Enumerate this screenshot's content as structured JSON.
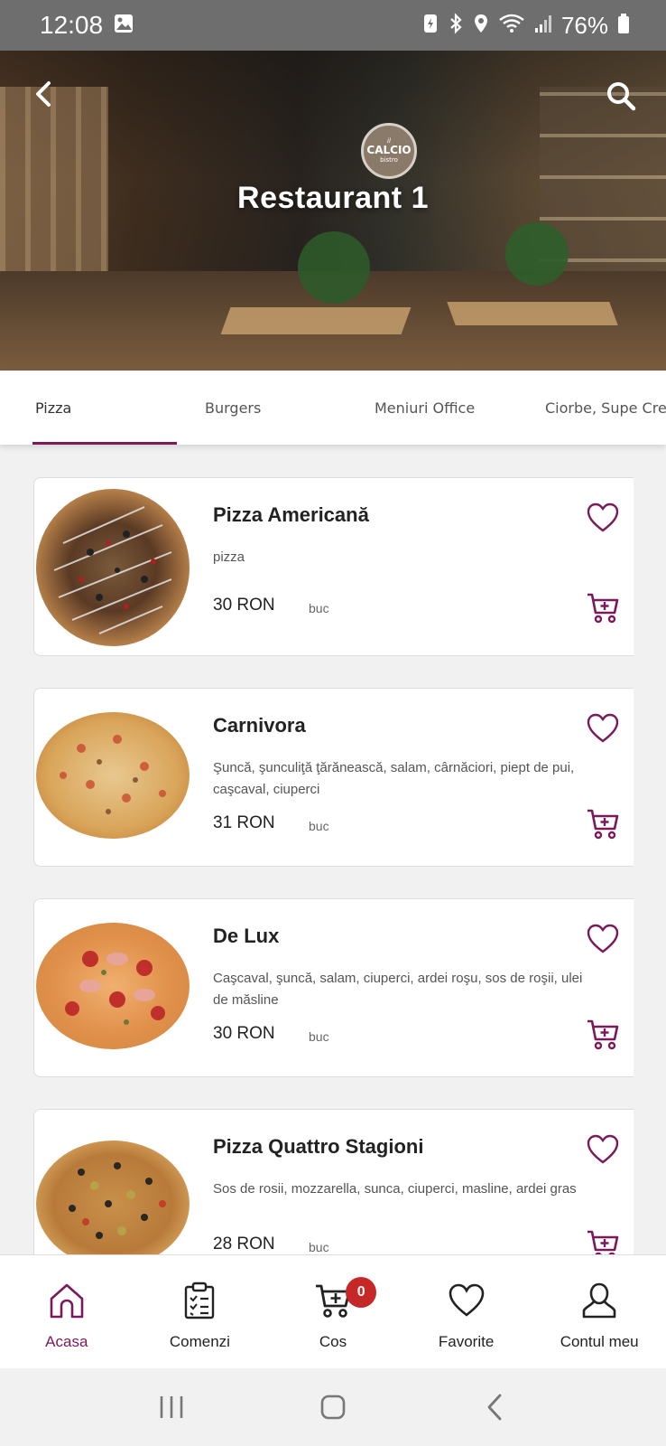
{
  "status_bar": {
    "time": "12:08",
    "battery": "76%"
  },
  "header": {
    "title": "Restaurant 1",
    "logo": {
      "top": "il",
      "name": "CALCIO",
      "sub": "bistro"
    }
  },
  "tabs": [
    {
      "label": "Pizza",
      "active": true
    },
    {
      "label": "Burgers",
      "active": false
    },
    {
      "label": "Meniuri Office",
      "active": false
    },
    {
      "label": "Ciorbe, Supe Creme",
      "active": false
    }
  ],
  "products": [
    {
      "name": "Pizza Americană",
      "description": "pizza",
      "price": "30 RON",
      "unit": "buc"
    },
    {
      "name": "Carnivora",
      "description": "Şuncă, şunculiţă ţărănească, salam, cârnăciori, piept de pui, caşcaval, ciuperci",
      "price": "31 RON",
      "unit": "buc"
    },
    {
      "name": "De Lux",
      "description": "Caşcaval, şuncă, salam, ciuperci, ardei roşu, sos de roşii, ulei de măsline",
      "price": "30 RON",
      "unit": "buc"
    },
    {
      "name": "Pizza Quattro Stagioni",
      "description": "Sos de rosii, mozzarella, sunca, ciuperci, masline, ardei gras",
      "price": "28 RON",
      "unit": "buc"
    }
  ],
  "bottom_nav": [
    {
      "label": "Acasa",
      "icon": "home-icon",
      "active": true
    },
    {
      "label": "Comenzi",
      "icon": "clipboard-icon",
      "active": false
    },
    {
      "label": "Cos",
      "icon": "cart-icon",
      "active": false,
      "badge": "0"
    },
    {
      "label": "Favorite",
      "icon": "heart-icon",
      "active": false
    },
    {
      "label": "Contul meu",
      "icon": "user-icon",
      "active": false
    }
  ],
  "colors": {
    "accent": "#7a1a5c",
    "badge": "#c62828"
  }
}
